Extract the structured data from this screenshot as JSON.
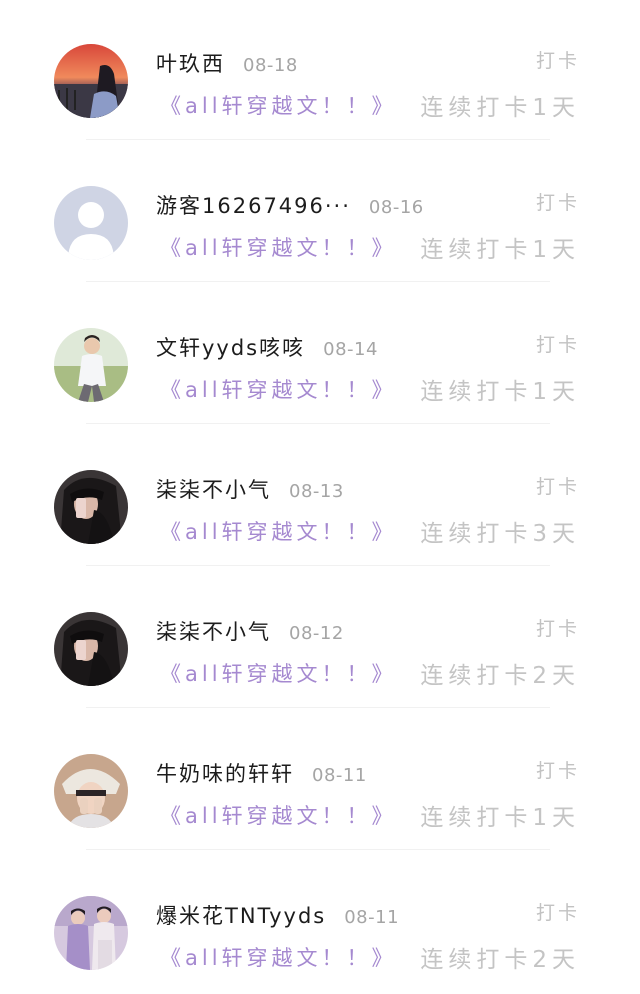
{
  "checkins": [
    {
      "username": "叶玖西",
      "date": "08-18",
      "action": "打卡",
      "book": "《all轩穿越文！！》",
      "streak": "连续打卡1天",
      "avatar": "sunset-girl-avatar"
    },
    {
      "username": "游客16267496···",
      "date": "08-16",
      "action": "打卡",
      "book": "《all轩穿越文！！》",
      "streak": "连续打卡1天",
      "avatar": "default-user-avatar"
    },
    {
      "username": "文轩yyds咳咳",
      "date": "08-14",
      "action": "打卡",
      "book": "《all轩穿越文！！》",
      "streak": "连续打卡1天",
      "avatar": "field-boy-avatar"
    },
    {
      "username": "柒柒不小气",
      "date": "08-13",
      "action": "打卡",
      "book": "《all轩穿越文！！》",
      "streak": "连续打卡3天",
      "avatar": "dark-hair-girl-avatar"
    },
    {
      "username": "柒柒不小气",
      "date": "08-12",
      "action": "打卡",
      "book": "《all轩穿越文！！》",
      "streak": "连续打卡2天",
      "avatar": "dark-hair-girl-avatar"
    },
    {
      "username": "牛奶味的轩轩",
      "date": "08-11",
      "action": "打卡",
      "book": "《all轩穿越文！！》",
      "streak": "连续打卡1天",
      "avatar": "bucket-hat-boy-avatar"
    },
    {
      "username": "爆米花TNTyyds",
      "date": "08-11",
      "action": "打卡",
      "book": "《all轩穿越文！！》",
      "streak": "连续打卡2天",
      "avatar": "two-boys-avatar"
    }
  ],
  "colors": {
    "book_title": "#a589d0",
    "streak": "#c4c4c4",
    "action": "#c2c2c2",
    "date": "#a5a5a5",
    "username": "#1c1c1c"
  }
}
